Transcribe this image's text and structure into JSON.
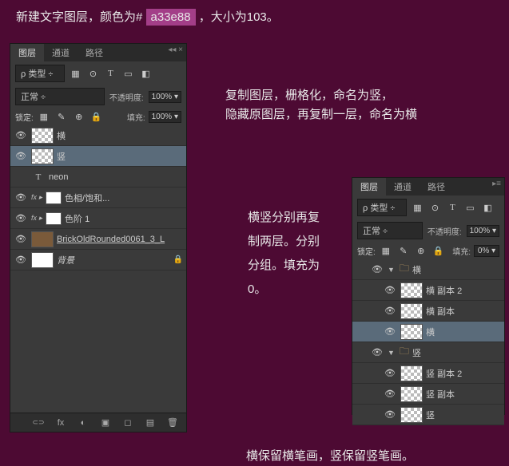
{
  "top_text": {
    "pre": "新建文字图层，颜色为#",
    "color": "a33e88",
    "post": "，大小为103。"
  },
  "caption_right": "复制图层，栅格化，命名为竖，\n隐藏原图层，再复制一层，命名为横",
  "caption_mid": "横竖分别再复制两层。分别分组。填充为0。",
  "caption_bottom": "横保留横笔画，竖保留竖笔画。",
  "panel": {
    "tabs": [
      "图层",
      "通道",
      "路径"
    ],
    "kind_label": "类型",
    "blend_mode": "正常",
    "opacity_label": "不透明度:",
    "opacity_value": "100%",
    "lock_label": "锁定:",
    "fill_label": "填充:",
    "fill_value_100": "100%",
    "fill_value_0": "0%"
  },
  "panel1_layers": [
    {
      "eye": true,
      "thumb": "trans",
      "name": "横"
    },
    {
      "eye": true,
      "thumb": "trans",
      "name": "竖",
      "selected": true
    },
    {
      "eye": false,
      "text_layer": true,
      "name": "neon"
    },
    {
      "eye": true,
      "fx": true,
      "mask": true,
      "name": "色相/饱和..."
    },
    {
      "eye": true,
      "fx": true,
      "mask": true,
      "name": "色阶 1"
    },
    {
      "eye": true,
      "thumb": "brick",
      "name": "BrickOldRounded0061_3_L",
      "underline": true
    },
    {
      "eye": true,
      "thumb": "white",
      "name": "背景",
      "italic": true,
      "locked": true
    }
  ],
  "panel2_groups": [
    {
      "name": "横",
      "layers": [
        {
          "name": "横 副本 2"
        },
        {
          "name": "横 副本"
        },
        {
          "name": "横",
          "selected": true
        }
      ]
    },
    {
      "name": "竖",
      "layers": [
        {
          "name": "竖 副本 2"
        },
        {
          "name": "竖 副本"
        },
        {
          "name": "竖"
        }
      ]
    }
  ],
  "icons": {
    "filter": [
      "▦",
      "⊙",
      "T",
      "▭",
      "◧"
    ],
    "lock": [
      "▦",
      "✎",
      "⊕",
      "🔒"
    ],
    "bottom": [
      "⊂⊃",
      "fx",
      "◐",
      "▣",
      "◻",
      "▤",
      "🗑"
    ]
  }
}
